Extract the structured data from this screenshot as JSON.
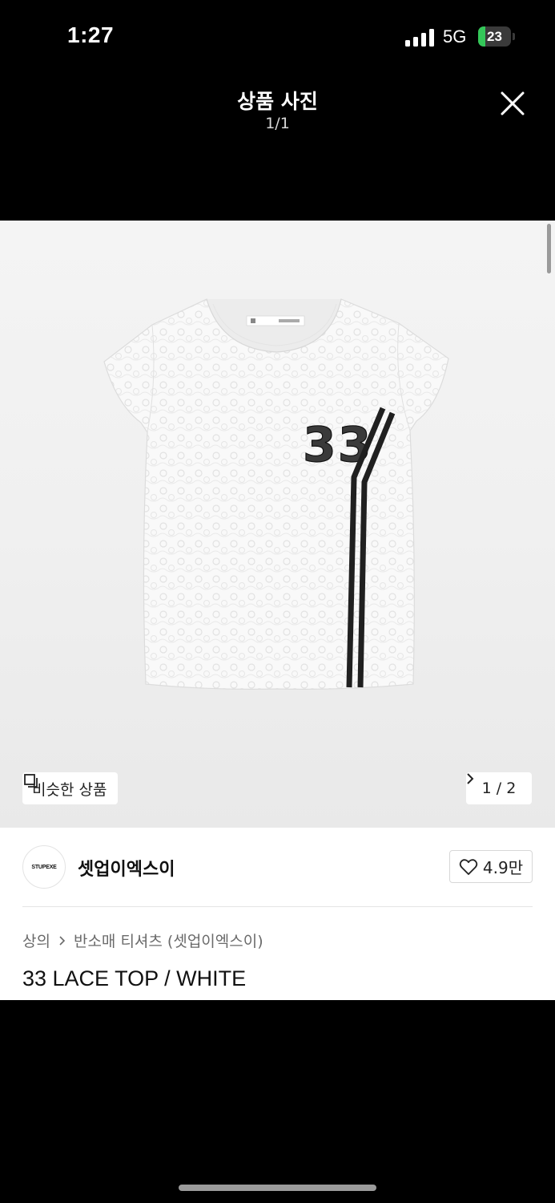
{
  "status_bar": {
    "time": "1:27",
    "network": "5G",
    "battery_level": "23",
    "battery_percent": 23,
    "battery_color": "#34c759"
  },
  "viewer": {
    "title": "상품 사진",
    "counter": "1/1",
    "close_icon": "close-icon"
  },
  "product_image": {
    "print_number": "33",
    "similar_button_label": "비슷한 상품",
    "similar_icon": "similar-items-icon",
    "page_indicator": "1 / 2",
    "page_icon": "chevron-right-icon"
  },
  "brand": {
    "logo_text": "STUPEXE",
    "name": "셋업이엑스이",
    "like_count": "4.9만",
    "like_icon": "heart-icon"
  },
  "breadcrumb": {
    "category": "상의",
    "separator_icon": "chevron-right-icon",
    "subcategory": "반소매 티셔츠 (셋업이엑스이)"
  },
  "product": {
    "title": "33 LACE TOP / WHITE"
  }
}
